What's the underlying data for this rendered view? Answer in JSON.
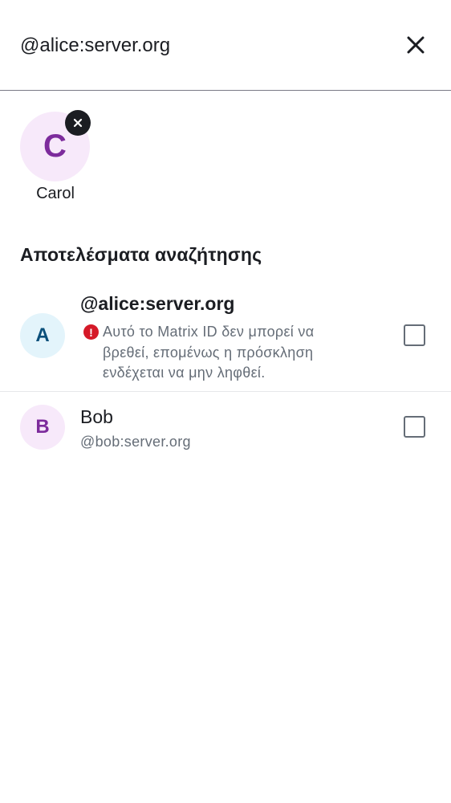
{
  "search": {
    "value": "@alice:server.org",
    "close_icon": "close-icon"
  },
  "selected": [
    {
      "initial": "C",
      "name": "Carol",
      "remove_icon": "close-icon"
    }
  ],
  "results": {
    "title": "Αποτελέσματα αναζήτησης",
    "items": [
      {
        "initial": "A",
        "title": "@alice:server.org",
        "warning_icon": "error-icon",
        "warning_glyph": "!",
        "warning": "Αυτό το Matrix ID δεν μπορεί να βρεθεί, επομένως η πρόσκληση ενδέχεται να μην ληφθεί.",
        "checked": false
      },
      {
        "initial": "B",
        "title": "Bob",
        "subtitle": "@bob:server.org",
        "checked": false
      }
    ]
  },
  "colors": {
    "avatar_purple_bg": "#f7e9fa",
    "avatar_purple_fg": "#7d2b9c",
    "avatar_blue_bg": "#e3f4fb",
    "avatar_blue_fg": "#0a4f7a",
    "error": "#d51928"
  }
}
